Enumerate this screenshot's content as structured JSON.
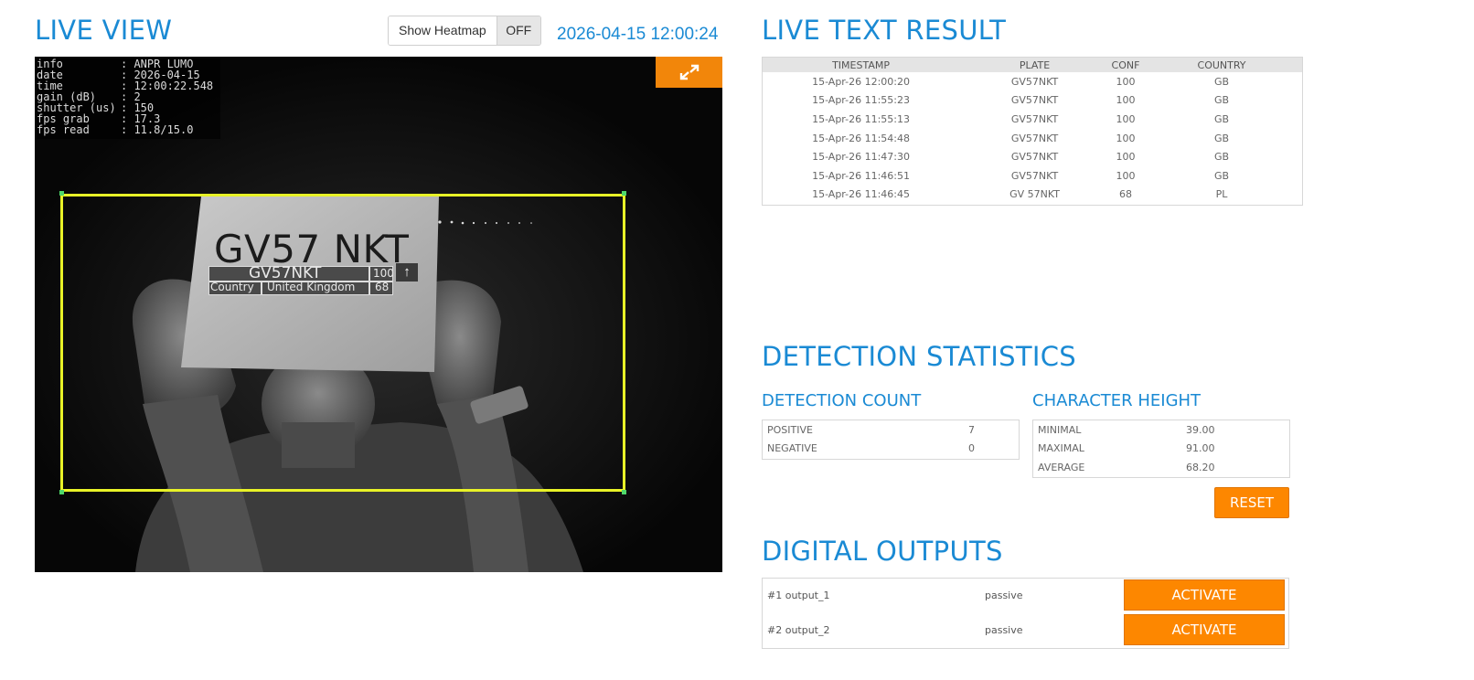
{
  "live_view": {
    "title": "LIVE VIEW",
    "heatmap_label": "Show Heatmap",
    "heatmap_state": "OFF",
    "datetime": "2026-04-15 12:00:24",
    "osd": [
      {
        "key": "info",
        "value": ": ANPR LUMO"
      },
      {
        "key": "date",
        "value": ": 2026-04-15"
      },
      {
        "key": "time",
        "value": ": 12:00:22.548"
      },
      {
        "key": "gain (dB)",
        "value": ": 2"
      },
      {
        "key": "shutter (us)",
        "value": ": 150"
      },
      {
        "key": "fps grab",
        "value": ": 17.3"
      },
      {
        "key": "fps read",
        "value": ": 11.8/15.0"
      }
    ],
    "plate_printed": "GV57 NKT",
    "overlay": {
      "plate": "GV57NKT",
      "confidence": "100",
      "country_label": "Country",
      "country": "United Kingdom",
      "country_confidence": "68"
    }
  },
  "live_text_result": {
    "title": "LIVE TEXT RESULT",
    "columns": [
      "TIMESTAMP",
      "PLATE",
      "CONF",
      "COUNTRY"
    ],
    "rows": [
      [
        "15-Apr-26 12:00:20",
        "GV57NKT",
        "100",
        "GB"
      ],
      [
        "15-Apr-26 11:55:23",
        "GV57NKT",
        "100",
        "GB"
      ],
      [
        "15-Apr-26 11:55:13",
        "GV57NKT",
        "100",
        "GB"
      ],
      [
        "15-Apr-26 11:54:48",
        "GV57NKT",
        "100",
        "GB"
      ],
      [
        "15-Apr-26 11:47:30",
        "GV57NKT",
        "100",
        "GB"
      ],
      [
        "15-Apr-26 11:46:51",
        "GV57NKT",
        "100",
        "GB"
      ],
      [
        "15-Apr-26 11:46:45",
        "GV 57NKT",
        "68",
        "PL"
      ]
    ]
  },
  "detection_statistics": {
    "title": "DETECTION STATISTICS",
    "count": {
      "title": "DETECTION COUNT",
      "rows": [
        {
          "label": "POSITIVE",
          "value": "7"
        },
        {
          "label": "NEGATIVE",
          "value": "0"
        }
      ]
    },
    "char_height": {
      "title": "CHARACTER HEIGHT",
      "rows": [
        {
          "label": "MINIMAL",
          "value": "39.00"
        },
        {
          "label": "MAXIMAL",
          "value": "91.00"
        },
        {
          "label": "AVERAGE",
          "value": "68.20"
        }
      ]
    },
    "reset_label": "RESET"
  },
  "digital_outputs": {
    "title": "DIGITAL OUTPUTS",
    "outputs": [
      {
        "name": "#1 output_1",
        "state": "passive",
        "action": "ACTIVATE"
      },
      {
        "name": "#2 output_2",
        "state": "passive",
        "action": "ACTIVATE"
      }
    ]
  },
  "colors": {
    "accent_blue": "#1a8ad4",
    "action_orange": "#fd8700",
    "roi_yellow": "#e8f227"
  }
}
